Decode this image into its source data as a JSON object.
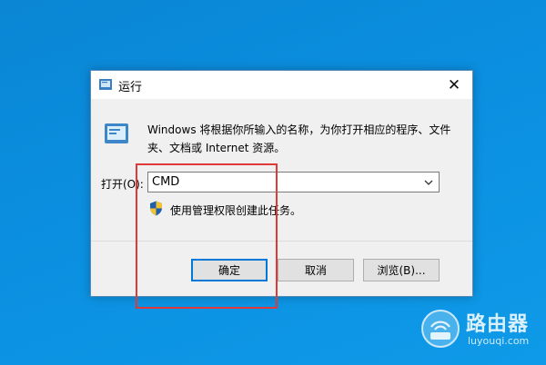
{
  "dialog": {
    "title": "运行",
    "close_glyph": "✕",
    "description": "Windows 将根据你所输入的名称，为你打开相应的程序、文件夹、文档或 Internet 资源。",
    "open_label": "打开(O):",
    "input_value": "CMD",
    "admin_note": "使用管理权限创建此任务。",
    "buttons": {
      "ok": "确定",
      "cancel": "取消",
      "browse": "浏览(B)..."
    }
  },
  "watermark": {
    "title": "路由器",
    "subtitle": "luyouqi.com"
  },
  "colors": {
    "desktop": "#0b8fe0",
    "highlight_box": "#e0393a",
    "accent": "#0078d7"
  }
}
